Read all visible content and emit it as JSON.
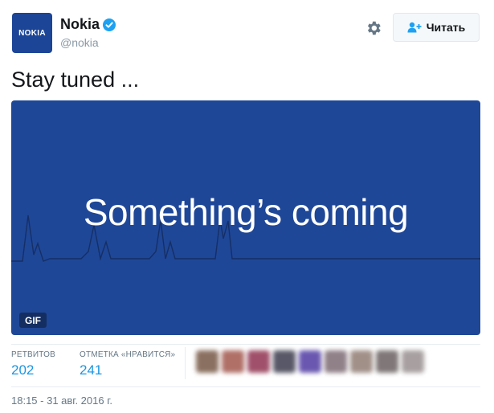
{
  "account": {
    "avatar_text": "NOKIA",
    "name": "Nokia",
    "handle": "@nokia",
    "verified": true,
    "brand_color": "#1c4597"
  },
  "actions": {
    "settings_icon": "gear-icon",
    "follow_label": "Читать",
    "follow_icon": "add-user-icon"
  },
  "tweet": {
    "text": "Stay tuned ...",
    "media": {
      "title": "Something’s coming",
      "badge": "GIF",
      "background": "#1f4797"
    }
  },
  "stats": {
    "retweets_label": "РЕТВИТОВ",
    "retweets_value": "202",
    "likes_label": "ОТМЕТКА «НРАВИТСЯ»",
    "likes_value": "241",
    "liker_avatars": [
      "#8a7060",
      "#b07068",
      "#a0506a",
      "#585868",
      "#6a58b0",
      "#908088",
      "#a09088",
      "#807878",
      "#a8a0a0"
    ]
  },
  "timestamp": "18:15 - 31 авг. 2016 г."
}
